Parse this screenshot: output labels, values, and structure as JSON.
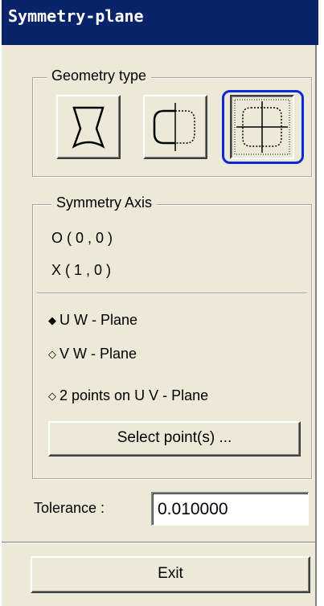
{
  "window": {
    "title": "Symmetry-plane"
  },
  "geometry_type": {
    "legend": "Geometry type",
    "buttons": [
      {
        "icon": "half-profile-icon",
        "selected": false
      },
      {
        "icon": "half-plane-axis-icon",
        "selected": false
      },
      {
        "icon": "full-plane-cross-icon",
        "selected": true
      }
    ]
  },
  "symmetry_axis": {
    "legend": "Symmetry Axis",
    "origin": "O ( 0 , 0 )",
    "x_axis": "X ( 1 , 0 )",
    "options": [
      {
        "label": "U W - Plane",
        "selected": true
      },
      {
        "label": "V W - Plane",
        "selected": false
      },
      {
        "label": "2 points on U V - Plane",
        "selected": false
      }
    ],
    "select_button": "Select point(s) ..."
  },
  "tolerance": {
    "label": "Tolerance :",
    "value": "0.010000"
  },
  "footer": {
    "exit_label": "Exit"
  },
  "colors": {
    "panel": "#ece9d8",
    "title_bar": "#0a246a",
    "selection_ring": "#0a2ad8"
  }
}
